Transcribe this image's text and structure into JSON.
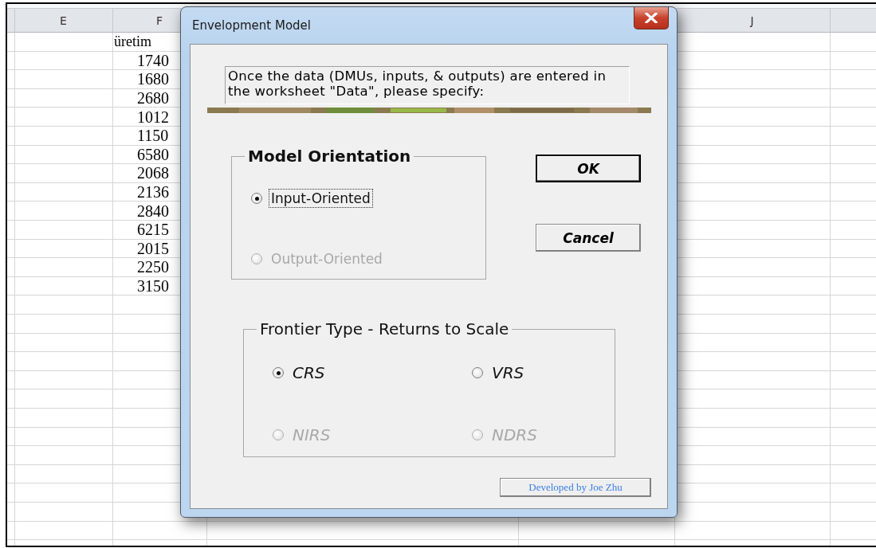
{
  "sheet": {
    "column_headers": [
      {
        "label": "E"
      },
      {
        "label": "F"
      },
      {
        "label": "J"
      }
    ],
    "column_f": [
      "üretim",
      "1740",
      "1680",
      "2680",
      "1012",
      "1150",
      "6580",
      "2068",
      "2136",
      "2840",
      "6215",
      "2015",
      "2250",
      "3150"
    ]
  },
  "dialog": {
    "title": "Envelopment Model",
    "message": "Once the data (DMUs, inputs, & outputs) are entered in the worksheet \"Data\", please specify:",
    "orientation": {
      "title": "Model Orientation",
      "options": [
        {
          "label": "Input-Oriented",
          "selected": true,
          "disabled": false,
          "focused": true
        },
        {
          "label": "Output-Oriented",
          "selected": false,
          "disabled": true,
          "focused": false
        }
      ]
    },
    "buttons": [
      {
        "label": "OK",
        "default": true
      },
      {
        "label": "Cancel",
        "default": false
      }
    ],
    "returns_to_scale": {
      "title": "Frontier Type - Returns to Scale",
      "options": [
        {
          "label": "CRS",
          "selected": true,
          "disabled": false
        },
        {
          "label": "VRS",
          "selected": false,
          "disabled": false
        },
        {
          "label": "NIRS",
          "selected": false,
          "disabled": true
        },
        {
          "label": "NDRS",
          "selected": false,
          "disabled": true
        }
      ]
    },
    "credit": "Developed by Joe Zhu"
  }
}
